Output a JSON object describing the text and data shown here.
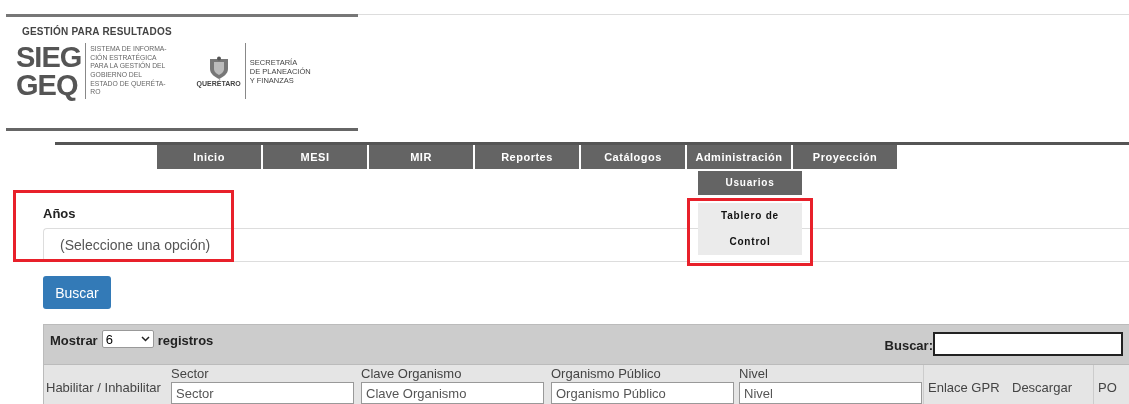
{
  "logo": {
    "tagline": "GESTIÓN PARA RESULTADOS",
    "mark_lines": [
      "SIEG",
      "GEQ"
    ],
    "description": "SISTEMA DE INFORMA-\nCIÓN ESTRATÉGICA\nPARA LA GESTIÓN DEL\nGOBIERNO DEL\nESTADO DE QUERÉTA-\nRO",
    "crest_caption": "QUERÉTARO",
    "secretariat": "SECRETARÍA\nDE PLANEACIÓN\nY FINANZAS"
  },
  "nav": [
    {
      "label": "Inicio"
    },
    {
      "label": "MESI"
    },
    {
      "label": "MIR"
    },
    {
      "label": "Reportes"
    },
    {
      "label": "Catálogos"
    },
    {
      "label": "Administración",
      "submenu": [
        {
          "label": "Usuarios",
          "kind": "dark",
          "highlighted": false
        },
        {
          "label": "Tablero de Control",
          "kind": "light",
          "highlighted": true
        }
      ]
    },
    {
      "label": "Proyección"
    }
  ],
  "filter": {
    "label": "Años",
    "placeholder": "(Seleccione una opción)",
    "highlighted": true
  },
  "search_button": "Buscar",
  "table": {
    "length_prefix": "Mostrar",
    "length_value": "6",
    "length_suffix": "registros",
    "search_label": "Buscar:",
    "columns": [
      {
        "title": "Habilitar / Inhabilitar"
      },
      {
        "title": "Sector",
        "placeholder": "Sector"
      },
      {
        "title": "Clave Organismo",
        "placeholder": "Clave Organismo"
      },
      {
        "title": "Organismo Público",
        "placeholder": "Organismo Público"
      },
      {
        "title": "Nivel",
        "placeholder": "Nivel"
      },
      {
        "title": "Enlace GPR"
      },
      {
        "title": "Descargar"
      },
      {
        "title": "PO"
      }
    ]
  }
}
